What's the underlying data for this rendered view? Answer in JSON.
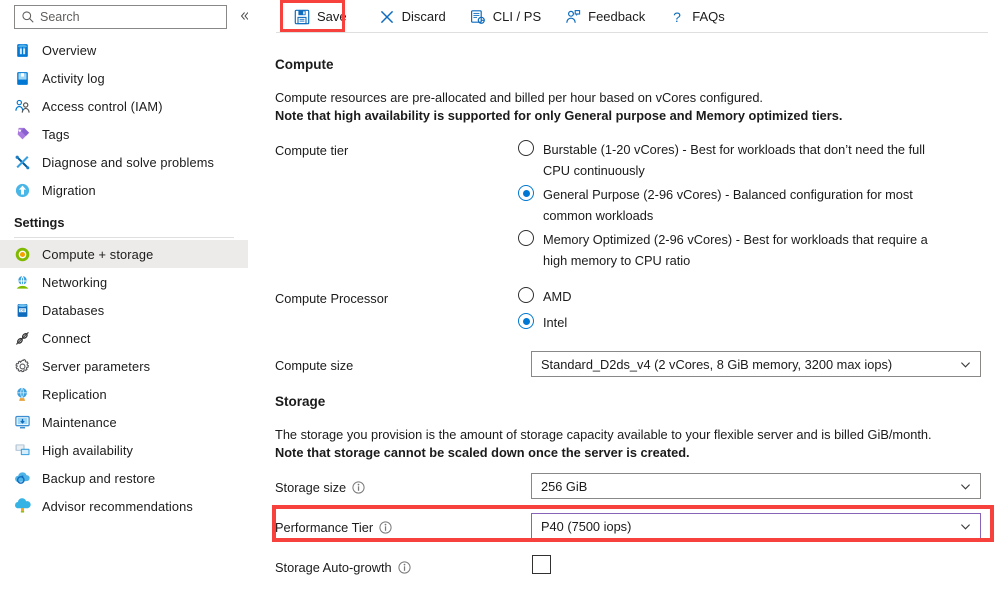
{
  "sidebar": {
    "search": {
      "placeholder": "Search",
      "value": ""
    },
    "collapse_label": "«",
    "items": [
      {
        "label": "Overview",
        "icon": "database-overview-icon",
        "selected": false
      },
      {
        "label": "Activity log",
        "icon": "activity-log-icon",
        "selected": false
      },
      {
        "label": "Access control (IAM)",
        "icon": "access-control-icon",
        "selected": false
      },
      {
        "label": "Tags",
        "icon": "tag-icon",
        "selected": false
      },
      {
        "label": "Diagnose and solve problems",
        "icon": "diagnose-icon",
        "selected": false
      },
      {
        "label": "Migration",
        "icon": "migration-icon",
        "selected": false
      }
    ],
    "group_label": "Settings",
    "settings_items": [
      {
        "label": "Compute + storage",
        "icon": "compute-storage-icon",
        "selected": true
      },
      {
        "label": "Networking",
        "icon": "networking-icon",
        "selected": false
      },
      {
        "label": "Databases",
        "icon": "databases-icon",
        "selected": false
      },
      {
        "label": "Connect",
        "icon": "connect-icon",
        "selected": false
      },
      {
        "label": "Server parameters",
        "icon": "gear-icon",
        "selected": false
      },
      {
        "label": "Replication",
        "icon": "replication-globe-icon",
        "selected": false
      },
      {
        "label": "Maintenance",
        "icon": "maintenance-icon",
        "selected": false
      },
      {
        "label": "High availability",
        "icon": "high-availability-icon",
        "selected": false
      },
      {
        "label": "Backup and restore",
        "icon": "backup-restore-icon",
        "selected": false
      },
      {
        "label": "Advisor recommendations",
        "icon": "advisor-icon",
        "selected": false
      }
    ]
  },
  "toolbar": {
    "save_label": "Save",
    "discard_label": "Discard",
    "cli_ps_label": "CLI / PS",
    "feedback_label": "Feedback",
    "faqs_label": "FAQs"
  },
  "compute": {
    "section_title": "Compute",
    "description_line1": "Compute resources are pre-allocated and billed per hour based on vCores configured.",
    "description_line2": "Note that high availability is supported for only General purpose and Memory optimized tiers.",
    "tier_label": "Compute tier",
    "tier_options": [
      {
        "label": "Burstable (1-20 vCores) - Best for workloads that don’t need the full CPU continuously",
        "selected": false
      },
      {
        "label": "General Purpose (2-96 vCores) - Balanced configuration for most common workloads",
        "selected": true
      },
      {
        "label": "Memory Optimized (2-96 vCores) - Best for workloads that require a high memory to CPU ratio",
        "selected": false
      }
    ],
    "processor_label": "Compute Processor",
    "processor_options": [
      {
        "label": "AMD",
        "selected": false
      },
      {
        "label": "Intel",
        "selected": true
      }
    ],
    "size_label": "Compute size",
    "size_value": "Standard_D2ds_v4 (2 vCores, 8 GiB memory, 3200 max iops)"
  },
  "storage": {
    "section_title": "Storage",
    "description_line1": "The storage you provision is the amount of storage capacity available to your flexible server and is billed GiB/month.",
    "description_line2": "Note that storage cannot be scaled down once the server is created.",
    "size_label": "Storage size",
    "size_value": "256 GiB",
    "perf_tier_label": "Performance Tier",
    "perf_tier_value": "P40 (7500 iops)",
    "autogrowth_label": "Storage Auto-growth",
    "autogrowth_checked": false
  },
  "colors": {
    "accent": "#0078d4",
    "highlight_red": "#f6413c",
    "focus_purple": "#8764b8",
    "selected_row": "#edebe9"
  }
}
